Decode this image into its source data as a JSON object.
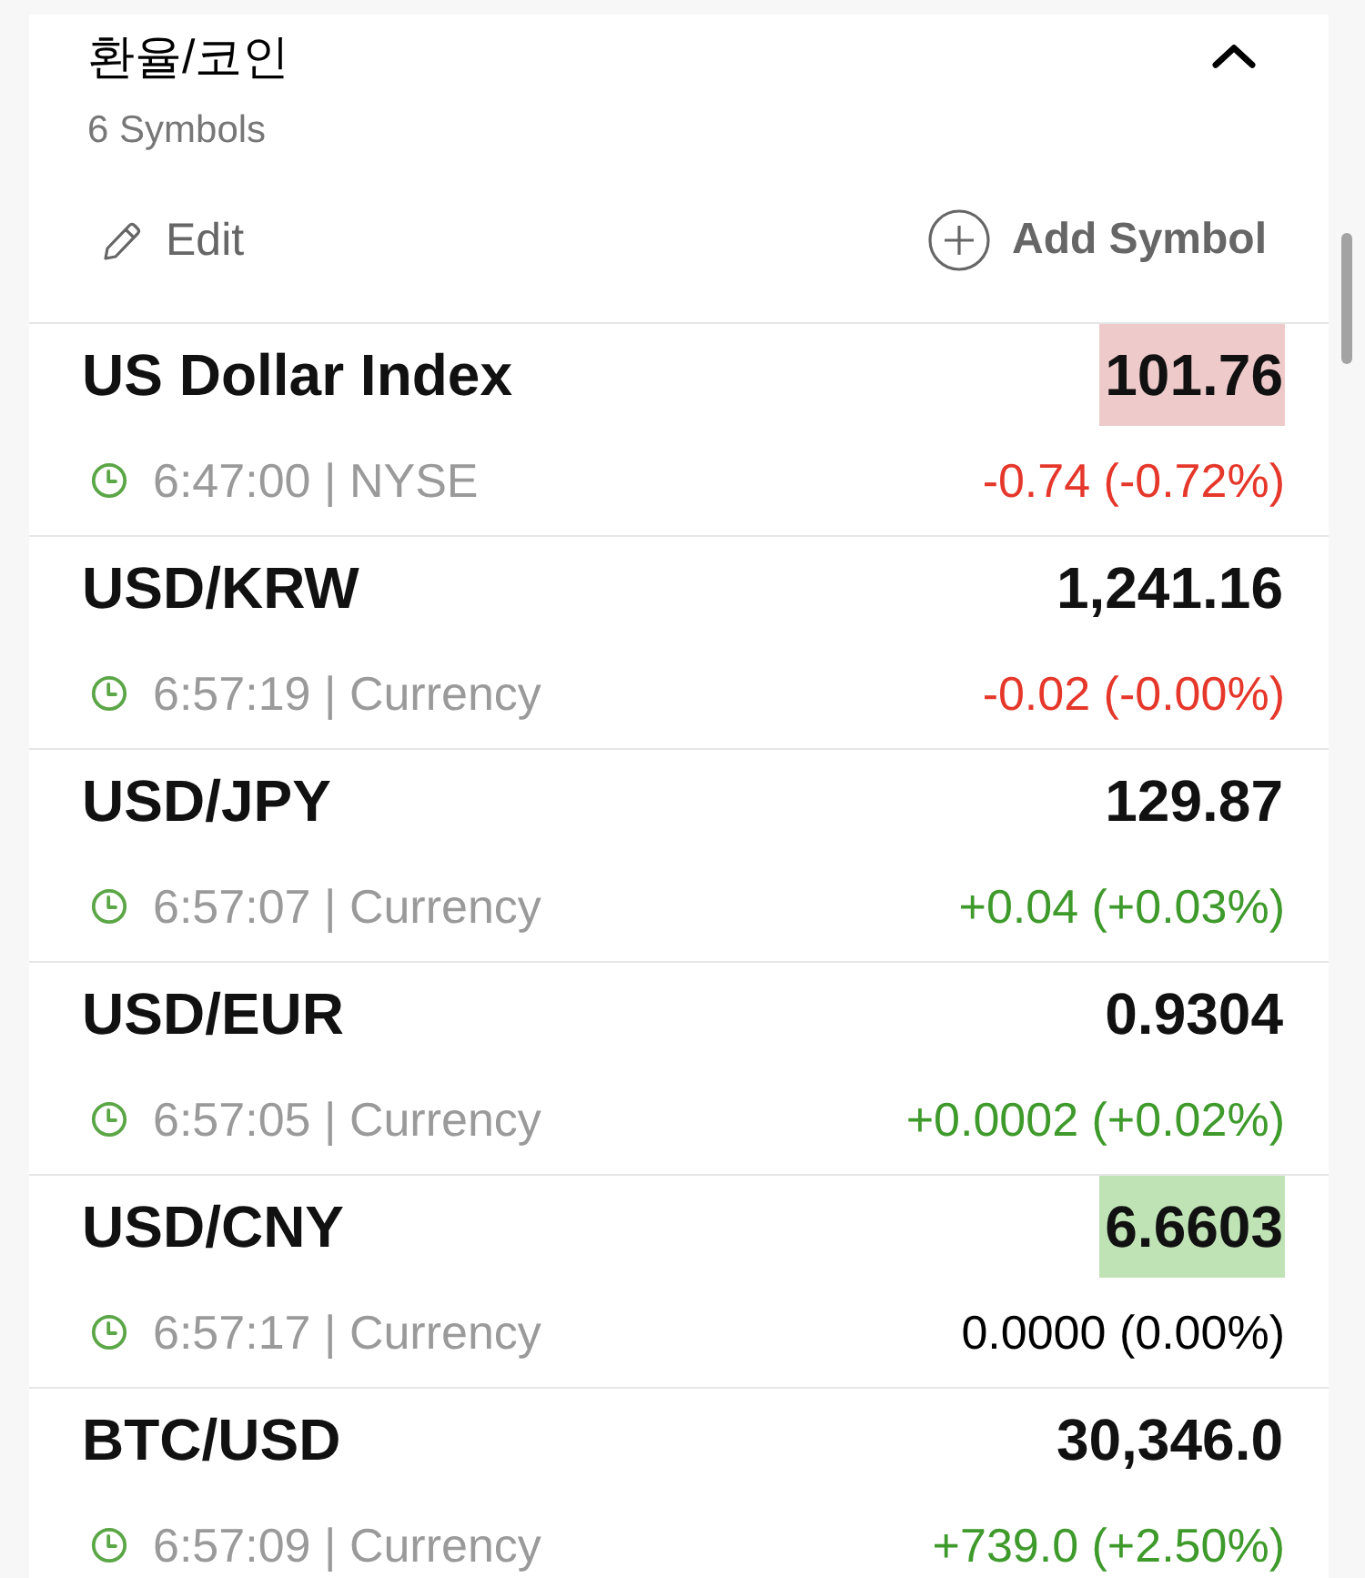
{
  "section": {
    "title": "환율/코인",
    "count": "6 Symbols",
    "expanded": true
  },
  "actions": {
    "edit": "Edit",
    "add": "Add Symbol"
  },
  "symbols": [
    {
      "name": "US Dollar Index",
      "price": "101.76",
      "flash_up": false,
      "flash_down": true,
      "info": "6:47:00 | NYSE",
      "change": "-0.74 (-0.72%)",
      "rising": false,
      "falling": true
    },
    {
      "name": "USD/KRW",
      "price": "1,241.16",
      "flash_up": false,
      "flash_down": false,
      "info": "6:57:19 | Currency",
      "change": "-0.02 (-0.00%)",
      "rising": false,
      "falling": true
    },
    {
      "name": "USD/JPY",
      "price": "129.87",
      "flash_up": false,
      "flash_down": false,
      "info": "6:57:07 | Currency",
      "change": "+0.04 (+0.03%)",
      "rising": true,
      "falling": false
    },
    {
      "name": "USD/EUR",
      "price": "0.9304",
      "flash_up": false,
      "flash_down": false,
      "info": "6:57:05 | Currency",
      "change": "+0.0002 (+0.02%)",
      "rising": true,
      "falling": false
    },
    {
      "name": "USD/CNY",
      "price": "6.6603",
      "flash_up": true,
      "flash_down": false,
      "info": "6:57:17 | Currency",
      "change": "0.0000 (0.00%)",
      "rising": false,
      "falling": false
    },
    {
      "name": "BTC/USD",
      "price": "30,346.0",
      "flash_up": false,
      "flash_down": false,
      "info": "6:57:09 | Currency",
      "change": "+739.0 (+2.50%)",
      "rising": true,
      "falling": false
    }
  ]
}
